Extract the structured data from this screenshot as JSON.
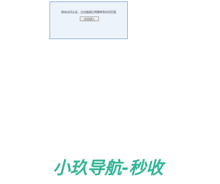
{
  "verify": {
    "message": "网站访问认证，点击链接后将跳转到访问页面",
    "button_label": "点击进入"
  },
  "watermark": {
    "text": "小玖导航-秒收",
    "color": "#31b597"
  }
}
